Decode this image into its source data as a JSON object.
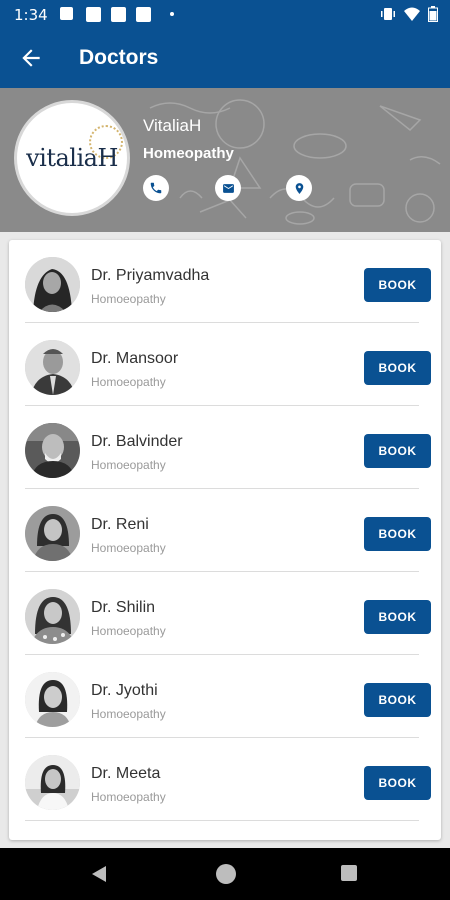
{
  "status_bar": {
    "time": "1:34"
  },
  "app_bar": {
    "title": "Doctors"
  },
  "organization": {
    "logo_text": "vitaliaH",
    "name": "VitaliaH",
    "specialty": "Homeopathy"
  },
  "book_label": "BOOK",
  "doctors": [
    {
      "name": "Dr. Priyamvadha",
      "specialty": "Homoeopathy"
    },
    {
      "name": "Dr. Mansoor",
      "specialty": "Homoeopathy"
    },
    {
      "name": "Dr. Balvinder",
      "specialty": "Homoeopathy"
    },
    {
      "name": "Dr. Reni",
      "specialty": "Homoeopathy"
    },
    {
      "name": "Dr. Shilin",
      "specialty": "Homoeopathy"
    },
    {
      "name": "Dr. Jyothi",
      "specialty": "Homoeopathy"
    },
    {
      "name": "Dr. Meeta",
      "specialty": "Homoeopathy"
    }
  ],
  "colors": {
    "primary": "#0a5192",
    "header_bg": "#8a8a8a",
    "text": "#333333",
    "subtext": "#9a9a9a"
  }
}
